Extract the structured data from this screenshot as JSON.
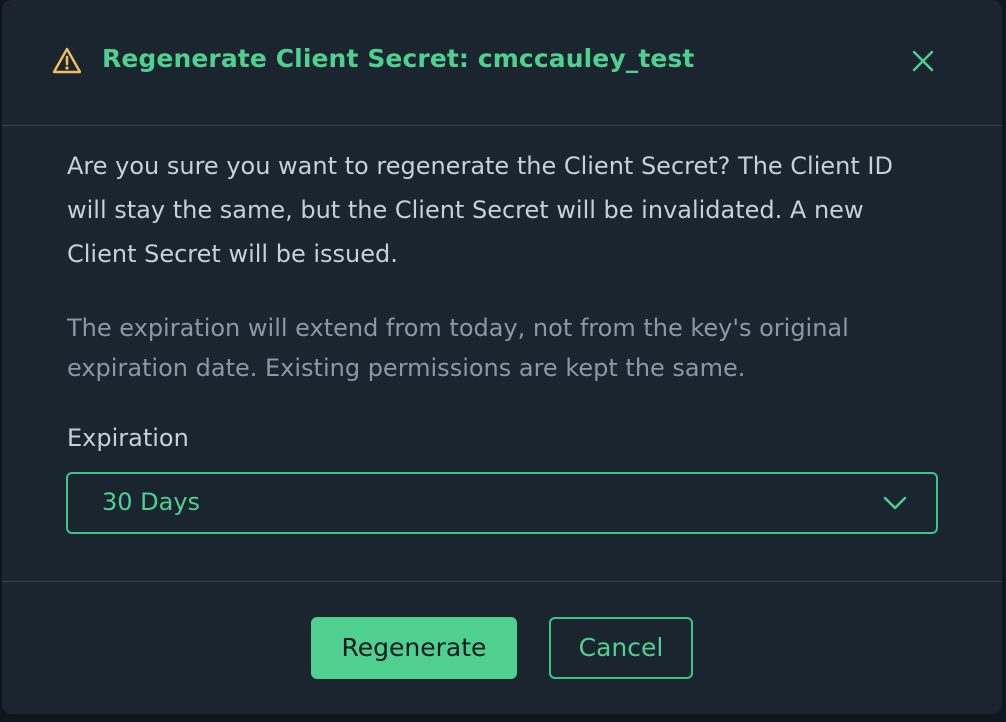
{
  "dialog": {
    "title": "Regenerate Client Secret: cmccauley_test",
    "icons": {
      "warning": "warning-icon",
      "close": "close-icon",
      "dropdown": "chevron-down-icon"
    },
    "message": "Are you sure you want to regenerate the Client Secret? The Client ID will stay the same, but the Client Secret will be invalidated. A new Client Secret will be issued.",
    "note": "The expiration will extend from today, not from the key's original expiration date. Existing permissions are kept the same.",
    "expiration": {
      "label": "Expiration",
      "selected": "30 Days"
    },
    "buttons": {
      "primary": "Regenerate",
      "secondary": "Cancel"
    }
  },
  "colors": {
    "accent": "#4fd08f",
    "warning": "#f0c060",
    "background": "#1a2530",
    "divider": "#35414b"
  }
}
